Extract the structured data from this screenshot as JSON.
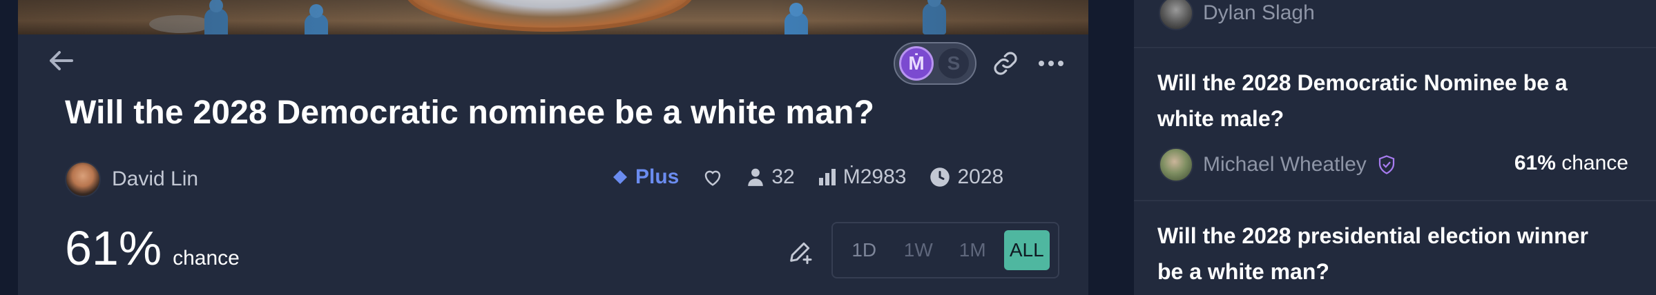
{
  "main": {
    "title": "Will the 2028 Democratic nominee be a white man?",
    "author": "David Lin",
    "badge": "Plus",
    "traders": "32",
    "volume": "Ṁ2983",
    "close": "2028",
    "probability": "61%",
    "probability_label": "chance",
    "currency_icons": [
      "mana-coin-icon",
      "sweepcash-coin-icon"
    ],
    "ranges": [
      "1D",
      "1W",
      "1M",
      "ALL"
    ],
    "active_range": "ALL"
  },
  "sidebar": {
    "items": [
      {
        "author": "Dylan Slagh"
      },
      {
        "title_line1": "Will the 2028 Democratic Nominee be a",
        "title_line2": "white male?",
        "author": "Michael Wheatley",
        "probability": "61%",
        "probability_label": "chance"
      },
      {
        "title_line1": "Will the 2028 presidential election winner",
        "title_line2": "be a white man?"
      }
    ]
  },
  "colors": {
    "background": "#131b2e",
    "card": "#222a3d",
    "accent_plus": "#6b8cf0",
    "active_tab": "#4fb7a0",
    "mana": "#7b4ad0"
  }
}
